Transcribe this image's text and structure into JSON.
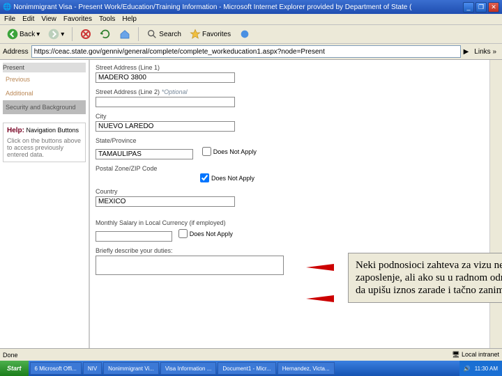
{
  "window": {
    "title": "Nonimmigrant Visa - Present Work/Education/Training Information - Microsoft Internet Explorer provided by Department of State (",
    "min": "_",
    "max": "❐",
    "close": "✕"
  },
  "menu": {
    "file": "File",
    "edit": "Edit",
    "view": "View",
    "favorites": "Favorites",
    "tools": "Tools",
    "help": "Help"
  },
  "toolbar": {
    "back": "Back",
    "search": "Search",
    "favorites": "Favorites"
  },
  "address": {
    "label": "Address",
    "url": "https://ceac.state.gov/genniv/general/complete/complete_workeducation1.aspx?node=Present",
    "links": "Links",
    "raquo": "»"
  },
  "sidebar": {
    "present": "Present",
    "previous": "Previous",
    "additional": "Additional",
    "security": "Security and Background"
  },
  "help": {
    "heading": "Help:",
    "title": "Navigation Buttons",
    "body": "Click on the buttons above to access previously entered data."
  },
  "form": {
    "streetaddr1_label": "Street Address (Line 1)",
    "streetaddr1_value": "MADERO 3800",
    "streetaddr2_label": "Street Address (Line 2)",
    "optional": "*Optional",
    "streetaddr2_value": "",
    "city_label": "City",
    "city_value": "NUEVO LAREDO",
    "state_label": "State/Province",
    "state_value": "TAMAULIPAS",
    "postal_label": "Postal Zone/ZIP Code",
    "dna": "Does Not Apply",
    "country_label": "Country",
    "country_value": "MEXICO",
    "salary_label": "Monthly Salary in Local Currency (if employed)",
    "salary_value": "",
    "duties_label": "Briefly describe your duties:"
  },
  "annotation": "Neki podnosioci zahteva za vizu nemaju zaposlenje, ali ako su u radnom odnosu, molimo da upišu iznos zarade i tačno zanimanje.",
  "status": {
    "done": "Done",
    "zone": "Local intranet"
  },
  "taskbar": {
    "start": "Start",
    "items": [
      "6 Microsoft Offi...",
      "NIV",
      "Nonimmigrant Vi...",
      "Visa Information ...",
      "Document1 - Micr...",
      "Hernandez, Victa..."
    ],
    "time": "11:30 AM"
  }
}
